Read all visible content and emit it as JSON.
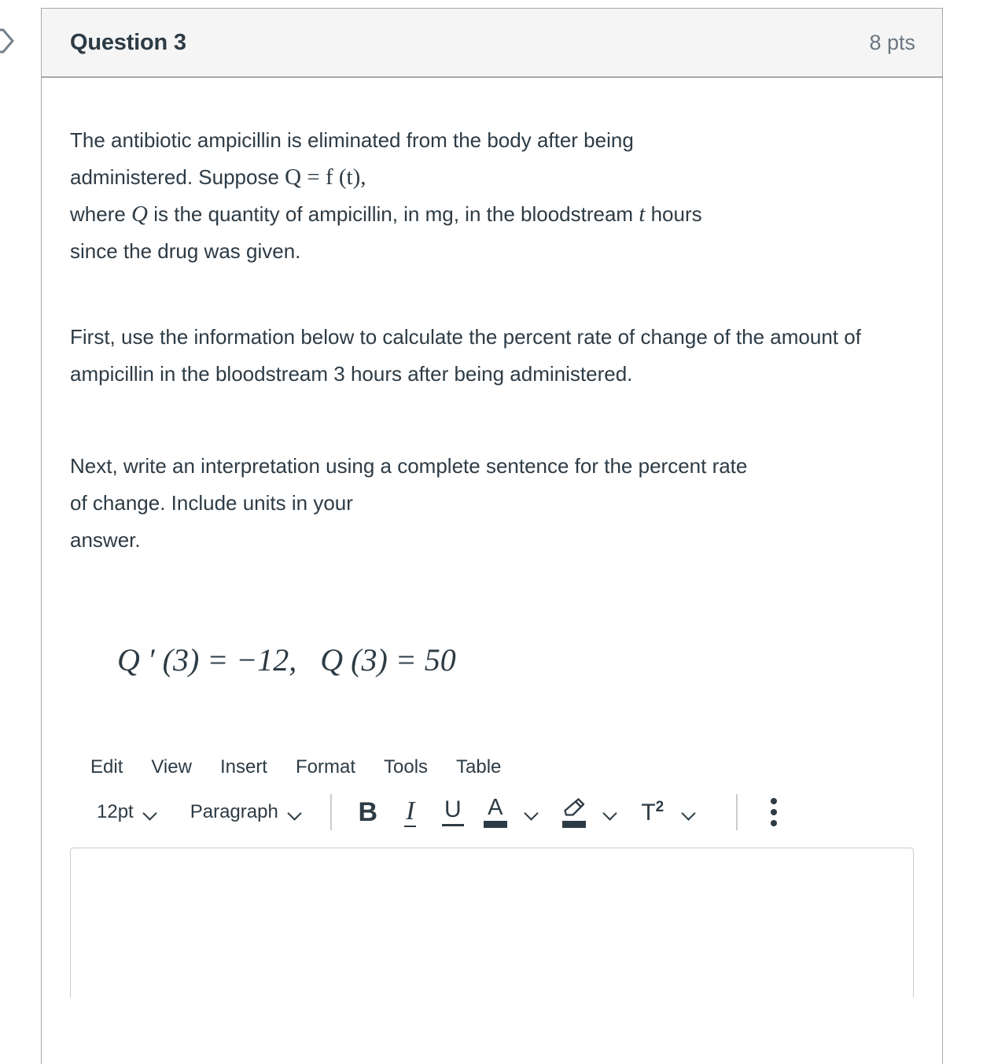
{
  "question": {
    "title": "Question 3",
    "points": "8 pts",
    "flag_icon": "bookmark-flag-icon"
  },
  "content": {
    "paragraph_1": {
      "line_1": "The antibiotic ampicillin is eliminated from the body after being",
      "line_2_prefix": "administered. Suppose ",
      "line_2_math": "Q = f (t),",
      "line_3_prefix": "where ",
      "line_3_var": "Q",
      "line_3_mid": " is the quantity of ampicillin, in mg, in the bloodstream ",
      "line_3_var2": "t",
      "line_3_suffix": " hours",
      "line_4": "since the drug was given."
    },
    "paragraph_2": "First, use the information below to calculate the percent rate of change of the amount of ampicillin in the bloodstream 3 hours after being administered.",
    "paragraph_3_line_1": "Next, write an interpretation using a complete sentence for the percent rate",
    "paragraph_3_line_2": "of change. Include units in your",
    "paragraph_3_line_3": "answer.",
    "display_math": "Q ′ (3) = −12,   Q (3) = 50"
  },
  "editor": {
    "menubar": [
      {
        "label": "Edit",
        "name": "menu-edit"
      },
      {
        "label": "View",
        "name": "menu-view"
      },
      {
        "label": "Insert",
        "name": "menu-insert"
      },
      {
        "label": "Format",
        "name": "menu-format"
      },
      {
        "label": "Tools",
        "name": "menu-tools"
      },
      {
        "label": "Table",
        "name": "menu-table"
      }
    ],
    "toolbar": {
      "font_size": "12pt",
      "block_format": "Paragraph",
      "bold_glyph": "B",
      "italic_glyph": "I",
      "underline_glyph": "U",
      "text_color_glyph": "A",
      "superscript_glyph": "T",
      "superscript_exponent": "2",
      "icons": {
        "bold": "bold-icon",
        "italic": "italic-icon",
        "underline": "underline-icon",
        "text_color": "text-color-icon",
        "highlight": "highlight-color-icon",
        "superscript": "superscript-icon",
        "more": "more-options-kebab-icon"
      }
    },
    "answer_placeholder": ""
  },
  "colors": {
    "text": "#2d3b45",
    "header_bg": "#f5f5f5",
    "border": "#a9a9a9",
    "muted": "#6b7780",
    "editor_border": "#c7cdd1",
    "flag": "#73818c"
  }
}
